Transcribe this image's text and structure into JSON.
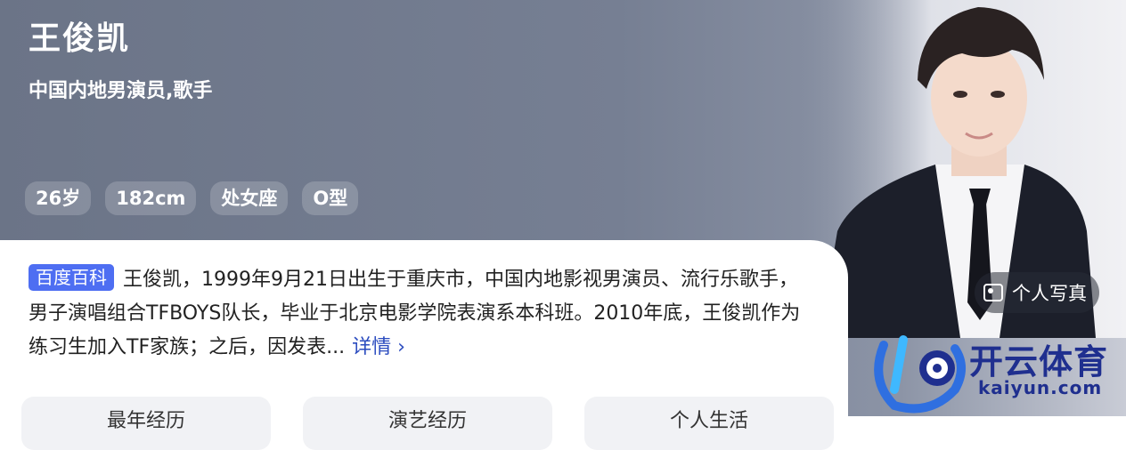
{
  "profile": {
    "name": "王俊凯",
    "occupation": "中国内地男演员,歌手",
    "tags": [
      "26岁",
      "182cm",
      "处女座",
      "O型"
    ]
  },
  "photo_button": {
    "label": "个人写真",
    "icon": "photo-icon"
  },
  "bio": {
    "source_badge": "百度百科",
    "text": "王俊凯，1999年9月21日出生于重庆市，中国内地影视男演员、流行乐歌手，男子演唱组合TFBOYS队长，毕业于北京电影学院表演系本科班。2010年底，王俊凯作为练习生加入TF家族；之后，因发表...",
    "more_label": "详情 ›"
  },
  "tabs": [
    "最年经历",
    "演艺经历",
    "个人生活"
  ],
  "watermark": {
    "brand": "开云体育",
    "url": "kaiyun.com"
  },
  "colors": {
    "hero_bg": "#767f93",
    "badge": "#4e6ef2",
    "link": "#2a4bbf",
    "logo": "#1f2f8f"
  }
}
